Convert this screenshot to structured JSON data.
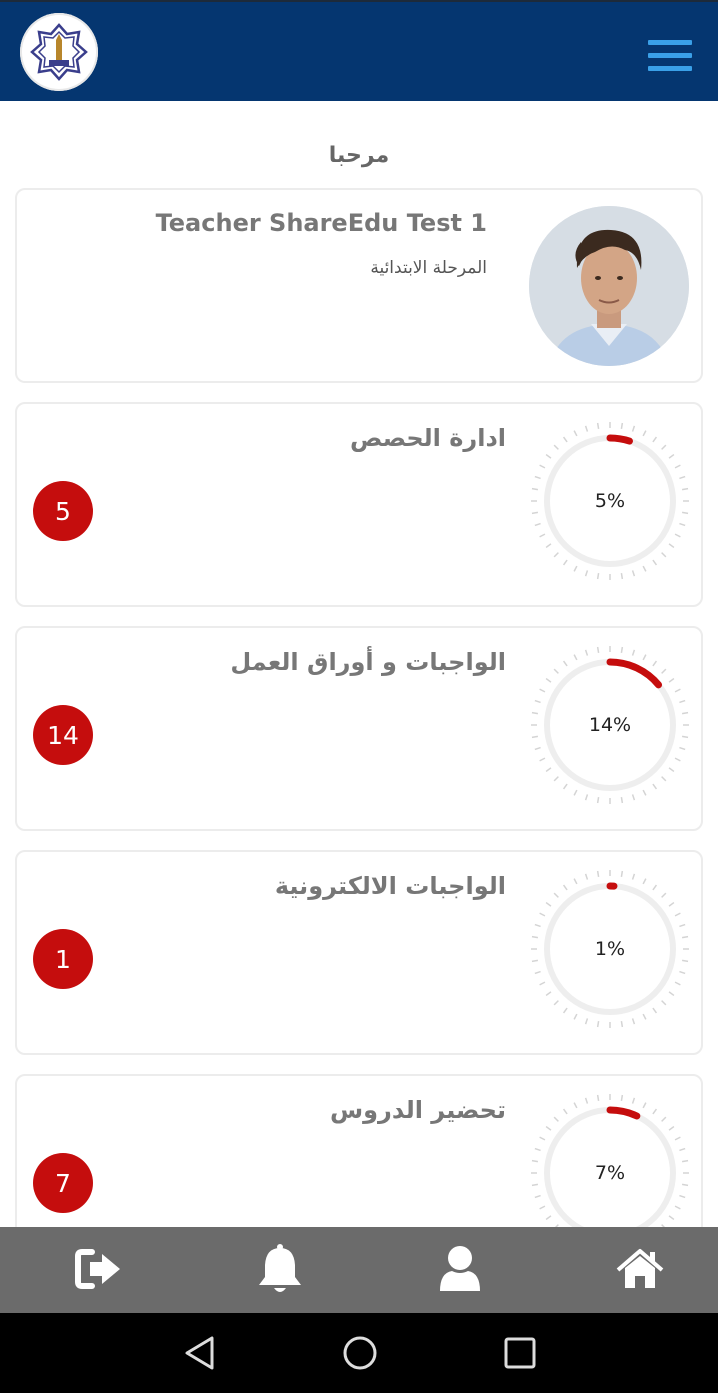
{
  "header": {
    "logo_icon": "school-logo-icon",
    "menu_icon": "hamburger-menu-icon",
    "background_color": "#053670",
    "menu_color": "#3aa0e8"
  },
  "greeting": "مرحبا",
  "profile": {
    "name": "Teacher ShareEdu Test 1",
    "stage": "المرحلة الابتدائية",
    "avatar_icon": "user-photo"
  },
  "stats": [
    {
      "title": "ادارة الحصص",
      "percent": 5,
      "percent_label": "5%",
      "count": "5"
    },
    {
      "title": "الواجبات و أوراق العمل",
      "percent": 14,
      "percent_label": "14%",
      "count": "14"
    },
    {
      "title": "الواجبات الالكترونية",
      "percent": 1,
      "percent_label": "1%",
      "count": "1"
    },
    {
      "title": "تحضير الدروس",
      "percent": 7,
      "percent_label": "7%",
      "count": "7"
    }
  ],
  "colors": {
    "accent_red": "#c50d0d",
    "gauge_track": "#eeeeee",
    "bottom_nav": "#6b6b6b"
  },
  "bottom_nav": [
    {
      "icon": "logout-icon"
    },
    {
      "icon": "bell-icon"
    },
    {
      "icon": "user-icon"
    },
    {
      "icon": "home-icon"
    }
  ],
  "system_nav": [
    {
      "icon": "back-triangle-icon"
    },
    {
      "icon": "home-circle-icon"
    },
    {
      "icon": "recents-square-icon"
    }
  ]
}
